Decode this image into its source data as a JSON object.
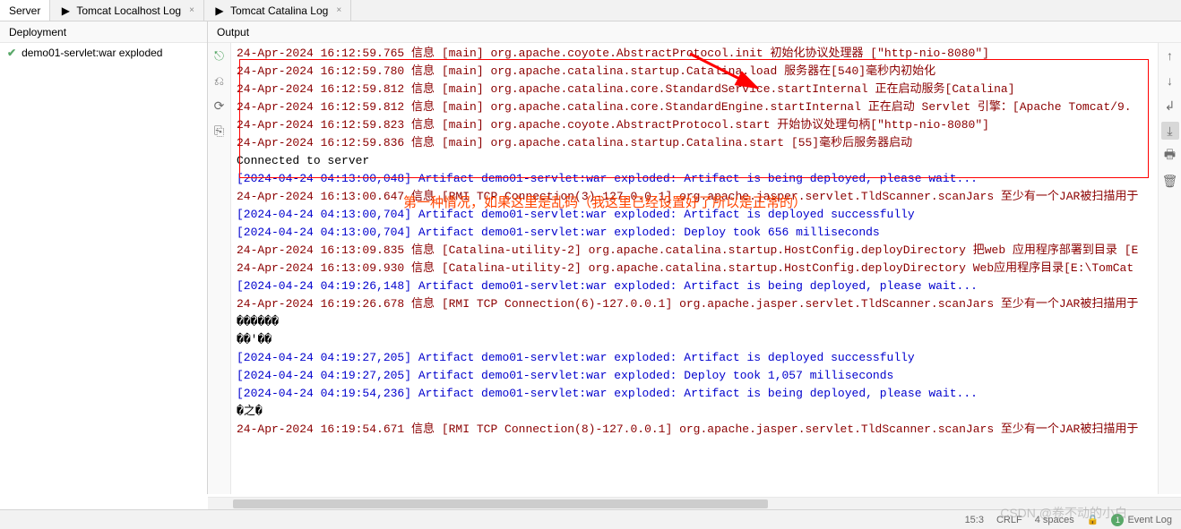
{
  "tabs": [
    {
      "label": "Server"
    },
    {
      "label": "Tomcat Localhost Log"
    },
    {
      "label": "Tomcat Catalina Log"
    }
  ],
  "left_panel": {
    "header": "Deployment",
    "item": "demo01-servlet:war exploded"
  },
  "right_panel": {
    "header": "Output"
  },
  "annotation": "第一种情况，如果这里是乱码（我这里已经设置好了所以是正常的）",
  "log_lines": [
    {
      "cls": "red-text",
      "text": "24-Apr-2024 16:12:59.765 信息 [main] org.apache.coyote.AbstractProtocol.init 初始化协议处理器 [\"http-nio-8080\"]"
    },
    {
      "cls": "red-text",
      "text": "24-Apr-2024 16:12:59.780 信息 [main] org.apache.catalina.startup.Catalina.load 服务器在[540]毫秒内初始化"
    },
    {
      "cls": "red-text",
      "text": "24-Apr-2024 16:12:59.812 信息 [main] org.apache.catalina.core.StandardService.startInternal 正在启动服务[Catalina]"
    },
    {
      "cls": "red-text",
      "text": "24-Apr-2024 16:12:59.812 信息 [main] org.apache.catalina.core.StandardEngine.startInternal 正在启动 Servlet 引擎：[Apache Tomcat/9."
    },
    {
      "cls": "red-text",
      "text": "24-Apr-2024 16:12:59.823 信息 [main] org.apache.coyote.AbstractProtocol.start 开始协议处理句柄[\"http-nio-8080\"]"
    },
    {
      "cls": "red-text",
      "text": "24-Apr-2024 16:12:59.836 信息 [main] org.apache.catalina.startup.Catalina.start [55]毫秒后服务器启动"
    },
    {
      "cls": "",
      "text": "Connected to server"
    },
    {
      "cls": "blue-text",
      "text": "[2024-04-24 04:13:00,048] Artifact demo01-servlet:war exploded: Artifact is being deployed, please wait..."
    },
    {
      "cls": "red-text",
      "text": "24-Apr-2024 16:13:00.647 信息 [RMI TCP Connection(3)-127.0.0.1] org.apache.jasper.servlet.TldScanner.scanJars 至少有一个JAR被扫描用于"
    },
    {
      "cls": "blue-text",
      "text": "[2024-04-24 04:13:00,704] Artifact demo01-servlet:war exploded: Artifact is deployed successfully"
    },
    {
      "cls": "blue-text",
      "text": "[2024-04-24 04:13:00,704] Artifact demo01-servlet:war exploded: Deploy took 656 milliseconds"
    },
    {
      "cls": "red-text",
      "text": "24-Apr-2024 16:13:09.835 信息 [Catalina-utility-2] org.apache.catalina.startup.HostConfig.deployDirectory 把web 应用程序部署到目录 [E"
    },
    {
      "cls": "red-text",
      "text": "24-Apr-2024 16:13:09.930 信息 [Catalina-utility-2] org.apache.catalina.startup.HostConfig.deployDirectory Web应用程序目录[E:\\TomCat"
    },
    {
      "cls": "blue-text",
      "text": "[2024-04-24 04:19:26,148] Artifact demo01-servlet:war exploded: Artifact is being deployed, please wait..."
    },
    {
      "cls": "red-text",
      "text": "24-Apr-2024 16:19:26.678 信息 [RMI TCP Connection(6)-127.0.0.1] org.apache.jasper.servlet.TldScanner.scanJars 至少有一个JAR被扫描用于"
    },
    {
      "cls": "",
      "text": "������"
    },
    {
      "cls": "",
      "text": "��'��"
    },
    {
      "cls": "blue-text",
      "text": "[2024-04-24 04:19:27,205] Artifact demo01-servlet:war exploded: Artifact is deployed successfully"
    },
    {
      "cls": "blue-text",
      "text": "[2024-04-24 04:19:27,205] Artifact demo01-servlet:war exploded: Deploy took 1,057 milliseconds"
    },
    {
      "cls": "blue-text",
      "text": "[2024-04-24 04:19:54,236] Artifact demo01-servlet:war exploded: Artifact is being deployed, please wait..."
    },
    {
      "cls": "",
      "text": "�之�"
    },
    {
      "cls": "red-text",
      "text": "24-Apr-2024 16:19:54.671 信息 [RMI TCP Connection(8)-127.0.0.1] org.apache.jasper.servlet.TldScanner.scanJars 至少有一个JAR被扫描用于"
    }
  ],
  "status": {
    "pos": "15:3",
    "crlf": "CRLF",
    "spaces": "4 spaces",
    "event_count": "1",
    "event_log": "Event Log"
  },
  "watermark": "CSDN @卷不动的小白"
}
